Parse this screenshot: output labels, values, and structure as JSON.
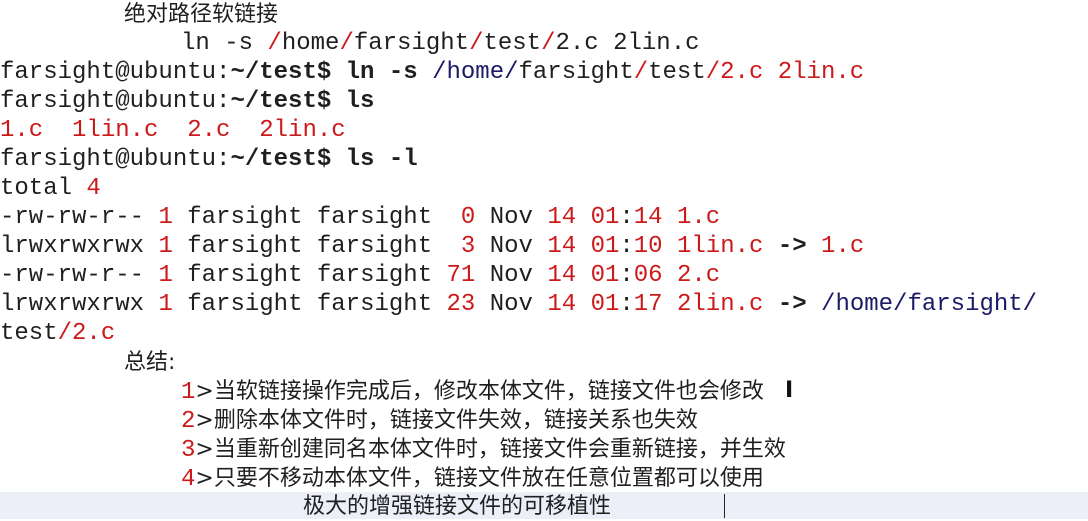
{
  "notes": {
    "heading": "绝对路径软链接",
    "example_cmd": {
      "a": "ln -s ",
      "b": "/",
      "c": "home",
      "d": "/",
      "e": "farsight",
      "f": "/",
      "g": "test",
      "h": "/",
      "i": "2.c 2lin.c"
    }
  },
  "terminal": {
    "prompt_user": "farsight@ubuntu:",
    "prompt_dir": "~/test$ ",
    "cmd1": {
      "a": "ln -s ",
      "b": "/home/",
      "c": "farsight",
      "d": "/",
      "e": "test",
      "f": "/",
      "g": "2.c 2lin.c"
    },
    "cmd2": "ls",
    "ls_output": "1.c  1lin.c  2.c  2lin.c",
    "cmd3": "ls -l",
    "total": {
      "label": "total ",
      "value": "4"
    },
    "rows": [
      {
        "perm": "-rw-rw-r--",
        "links": "1",
        "owner": "farsight farsight",
        "size": " 0",
        "mon": "Nov",
        "day": "14",
        "h": "01",
        "m": "14",
        "name": "1.c"
      },
      {
        "perm": "lrwxrwxrwx",
        "links": "1",
        "owner": "farsight farsight",
        "size": " 3",
        "mon": "Nov",
        "day": "14",
        "h": "01",
        "m": "10",
        "name": "1lin.c"
      },
      {
        "perm": "-rw-rw-r--",
        "links": "1",
        "owner": "farsight farsight",
        "size": "71",
        "mon": "Nov",
        "day": "14",
        "h": "01",
        "m": "06",
        "name": "2.c"
      },
      {
        "perm": "lrwxrwxrwx",
        "links": "1",
        "owner": "farsight farsight",
        "size": "23",
        "mon": "Nov",
        "day": "14",
        "h": "01",
        "m": "17",
        "name": "2lin.c"
      }
    ],
    "arrow": "->",
    "row2_target": "1.c",
    "row4_target_a": "/home/farsight/",
    "row4_target_b": "test",
    "row4_target_c": "/",
    "row4_target_d": "2.c"
  },
  "summary": {
    "title": "总结:",
    "items": [
      {
        "num": "1",
        "text": ">当软链接操作完成后，修改本体文件，链接文件也会修改"
      },
      {
        "num": "2",
        "text": ">删除本体文件时，链接文件失效，链接关系也失效"
      },
      {
        "num": "3",
        "text": ">当重新创建同名本体文件时，链接文件会重新链接，并生效"
      },
      {
        "num": "4",
        "text": ">只要不移动本体文件，链接文件放在任意位置都可以使用"
      }
    ],
    "conclusion": "极大的增强链接文件的可移植性"
  }
}
